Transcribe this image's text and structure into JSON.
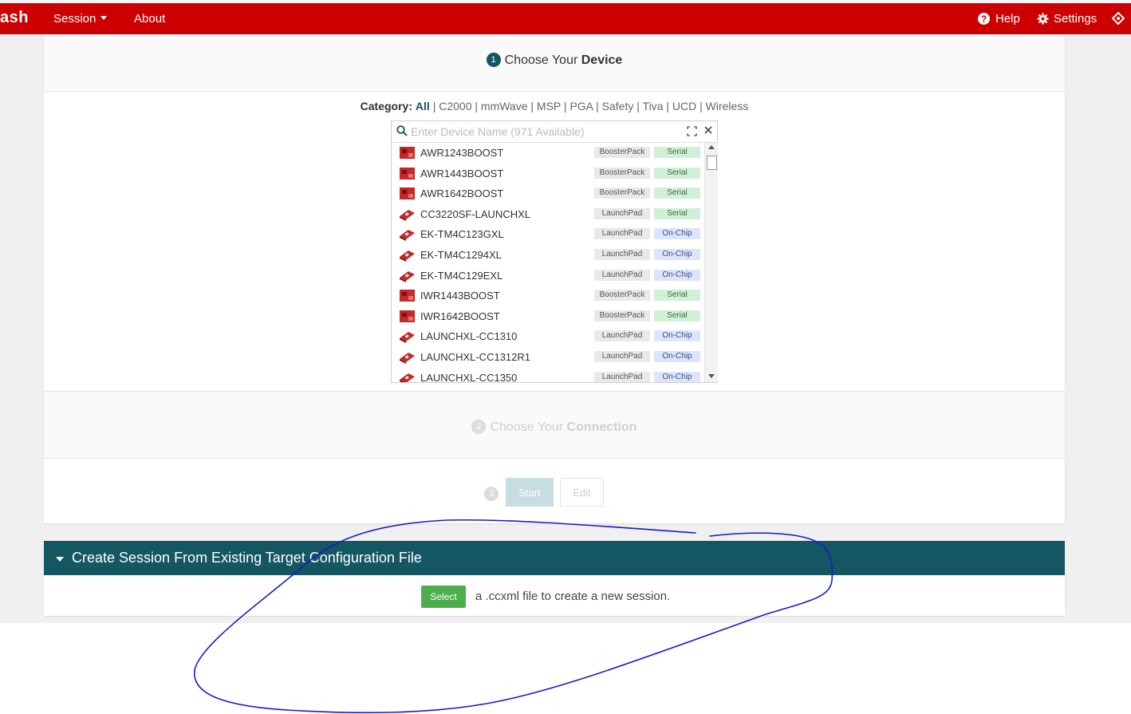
{
  "navbar": {
    "brand": "ash",
    "session": "Session",
    "about": "About",
    "help": "Help",
    "settings": "Settings"
  },
  "step1": {
    "num": "1",
    "prefix": "Choose Your ",
    "bold": "Device"
  },
  "category": {
    "label": "Category:",
    "items": [
      "All",
      "C2000",
      "mmWave",
      "MSP",
      "PGA",
      "Safety",
      "Tiva",
      "UCD",
      "Wireless"
    ]
  },
  "search": {
    "placeholder": "Enter Device Name (971 Available)",
    "value": ""
  },
  "devices": [
    {
      "name": "AWR1243BOOST",
      "type": "BoosterPack",
      "conn": "Serial"
    },
    {
      "name": "AWR1443BOOST",
      "type": "BoosterPack",
      "conn": "Serial"
    },
    {
      "name": "AWR1642BOOST",
      "type": "BoosterPack",
      "conn": "Serial"
    },
    {
      "name": "CC3220SF-LAUNCHXL",
      "type": "LaunchPad",
      "conn": "Serial"
    },
    {
      "name": "EK-TM4C123GXL",
      "type": "LaunchPad",
      "conn": "On-Chip"
    },
    {
      "name": "EK-TM4C1294XL",
      "type": "LaunchPad",
      "conn": "On-Chip"
    },
    {
      "name": "EK-TM4C129EXL",
      "type": "LaunchPad",
      "conn": "On-Chip"
    },
    {
      "name": "IWR1443BOOST",
      "type": "BoosterPack",
      "conn": "Serial"
    },
    {
      "name": "IWR1642BOOST",
      "type": "BoosterPack",
      "conn": "Serial"
    },
    {
      "name": "LAUNCHXL-CC1310",
      "type": "LaunchPad",
      "conn": "On-Chip"
    },
    {
      "name": "LAUNCHXL-CC1312R1",
      "type": "LaunchPad",
      "conn": "On-Chip"
    },
    {
      "name": "LAUNCHXL-CC1350",
      "type": "LaunchPad",
      "conn": "On-Chip"
    }
  ],
  "step2": {
    "num": "2",
    "prefix": "Choose Your ",
    "bold": "Connection"
  },
  "step3": {
    "num": "3",
    "start": "Start",
    "edit": "Edit"
  },
  "create_session": {
    "title": "Create Session From Existing Target Configuration File",
    "select": "Select",
    "text": "a .ccxml file to create a new session."
  },
  "colors": {
    "brand_red": "#cc0000",
    "teal": "#145662",
    "select_green": "#4cae4c",
    "annotation_blue": "#1a1acc"
  },
  "icons": [
    "help-icon",
    "gear-icon",
    "user-icon",
    "search-icon",
    "expand-icon",
    "close-icon",
    "caret-down-icon",
    "board-thumbnail-icon"
  ]
}
